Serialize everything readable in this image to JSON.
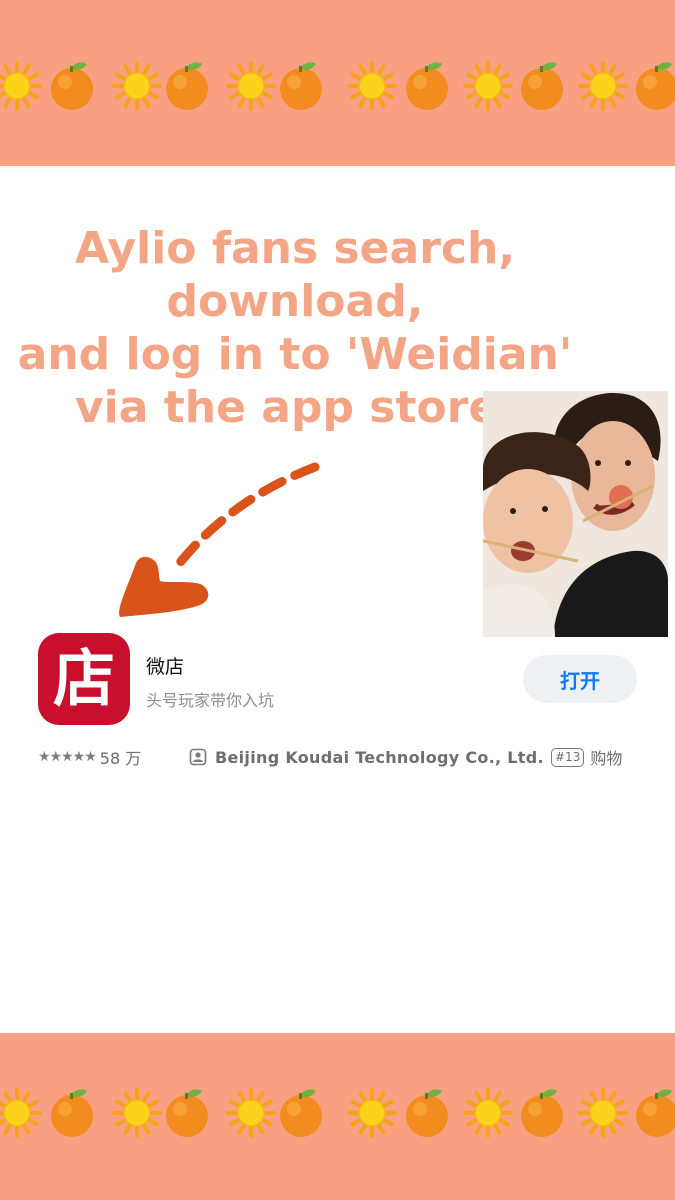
{
  "banner": {
    "emojis": [
      "sun-icon",
      "orange-icon",
      "sun-icon",
      "orange-icon",
      "sun-icon",
      "orange-icon",
      "sun-icon",
      "orange-icon",
      "sun-icon",
      "orange-icon",
      "sun-icon",
      "orange-icon"
    ]
  },
  "headline": {
    "line1": "Aylio fans search,",
    "line2": "download,",
    "line3": "and log in to 'Weidian'",
    "line4": "via the app store."
  },
  "app": {
    "icon_glyph": "店",
    "name": "微店",
    "subtitle": "头号玩家带你入坑",
    "open_label": "打开",
    "rating_stars": "★★★★★",
    "rating_count": "58 万",
    "developer": "Beijing Koudai Technology Co., Ltd.",
    "rank": "#13",
    "category": "购物"
  },
  "colors": {
    "banner": "#f9a082",
    "headline": "#f4a585",
    "arrow": "#d9541a",
    "app_icon": "#c8102e",
    "open_button_text": "#0a7aff"
  }
}
